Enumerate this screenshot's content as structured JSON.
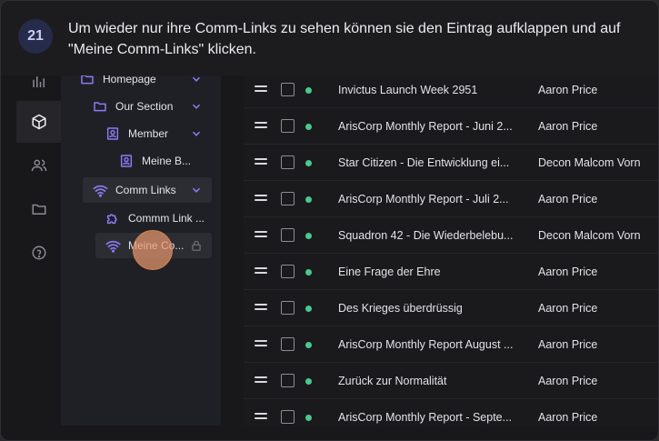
{
  "tutorial": {
    "step_number": "21",
    "instruction": "Um wieder nur ihre Comm-Links zu sehen können sie den Eintrag aufklappen und auf \"Meine Comm-Links\" klicken."
  },
  "rail": {
    "icons": [
      "dashboard-icon",
      "cube-icon",
      "users-icon",
      "folder-icon",
      "help-icon"
    ],
    "active": "cube-icon"
  },
  "tree": {
    "items": [
      {
        "label": "Homepage",
        "icon": "folder-icon"
      },
      {
        "label": "Our Section",
        "icon": "folder-icon"
      },
      {
        "label": "Member",
        "icon": "badge-icon"
      },
      {
        "label": "Meine B...",
        "icon": "badge-icon"
      },
      {
        "label": "Comm Links",
        "icon": "wifi-icon"
      },
      {
        "label": "Commm Link ...",
        "icon": "puzzle-icon"
      },
      {
        "label": "Meine Co...",
        "icon": "wifi-icon"
      }
    ]
  },
  "list": {
    "rows": [
      {
        "title": "Invictus Launch Week 2951",
        "author": "Aaron Price"
      },
      {
        "title": "ArisCorp Monthly Report - Juni 2...",
        "author": "Aaron Price"
      },
      {
        "title": "Star Citizen - Die Entwicklung ei...",
        "author": "Decon Malcom Vorn"
      },
      {
        "title": "ArisCorp Monthly Report - Juli 2...",
        "author": "Aaron Price"
      },
      {
        "title": "Squadron 42 - Die Wiederbelebu...",
        "author": "Decon Malcom Vorn"
      },
      {
        "title": "Eine Frage der Ehre",
        "author": "Aaron Price"
      },
      {
        "title": "Des Krieges überdrüssig",
        "author": "Aaron Price"
      },
      {
        "title": "ArisCorp Monthly Report August ...",
        "author": "Aaron Price"
      },
      {
        "title": "Zurück zur Normalität",
        "author": "Aaron Price"
      },
      {
        "title": "ArisCorp Monthly Report - Septe...",
        "author": "Aaron Price"
      }
    ]
  },
  "colors": {
    "accent": "#8b7cf6",
    "status_dot": "#49c98a",
    "click_marker": "#e6966e"
  }
}
